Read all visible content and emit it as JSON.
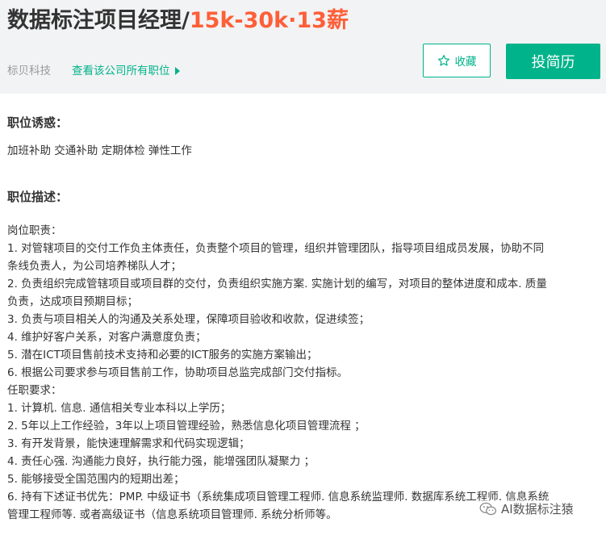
{
  "header": {
    "title": "数据标注项目经理/",
    "salary": "15k-30k·13薪",
    "company": "标贝科技",
    "company_link": "查看该公司所有职位",
    "favorite_label": "收藏",
    "apply_label": "投简历"
  },
  "perks": {
    "heading": "职位诱惑：",
    "text": "加班补助 交通补助 定期体检 弹性工作"
  },
  "description": {
    "heading": "职位描述：",
    "lines": [
      "岗位职责：",
      "1. 对管辖项目的交付工作负主体责任，负责整个项目的管理，组织并管理团队，指导项目组成员发展，协助不同",
      "条线负责人，为公司培养梯队人才；",
      "2. 负责组织完成管辖项目或项目群的交付，负责组织实施方案. 实施计划的编写，对项目的整体进度和成本. 质量",
      "负责，达成项目预期目标；",
      "3. 负责与项目相关人的沟通及关系处理，保障项目验收和收款，促进续签；",
      "4. 维护好客户关系，对客户满意度负责；",
      "5. 潜在ICT项目售前技术支持和必要的ICT服务的实施方案输出；",
      "6. 根据公司要求参与项目售前工作，协助项目总监完成部门交付指标。",
      "任职要求：",
      "1. 计算机. 信息. 通信相关专业本科以上学历；",
      "2. 5年以上工作经验，3年以上项目管理经验，熟悉信息化项目管理流程 ；",
      "3. 有开发背景，能快速理解需求和代码实现逻辑；",
      "4. 责任心强. 沟通能力良好，执行能力强，能增强团队凝聚力 ；",
      "5. 能够接受全国范围内的短期出差；",
      "6. 持有下述证书优先：PMP. 中级证书（系统集成项目管理工程师. 信息系统监理师. 数据库系统工程师. 信息系统",
      "管理工程师等. 或者高级证书（信息系统项目管理师. 系统分析师等。"
    ]
  },
  "watermark": {
    "text": "AI数据标注猿"
  },
  "colors": {
    "accent": "#00b38a",
    "salary": "#fd5f39",
    "header_bg": "#f2f3f4"
  },
  "icons": {
    "favorite": "star-outline-icon",
    "link_arrow": "triangle-right-icon",
    "watermark": "wechat-icon"
  }
}
